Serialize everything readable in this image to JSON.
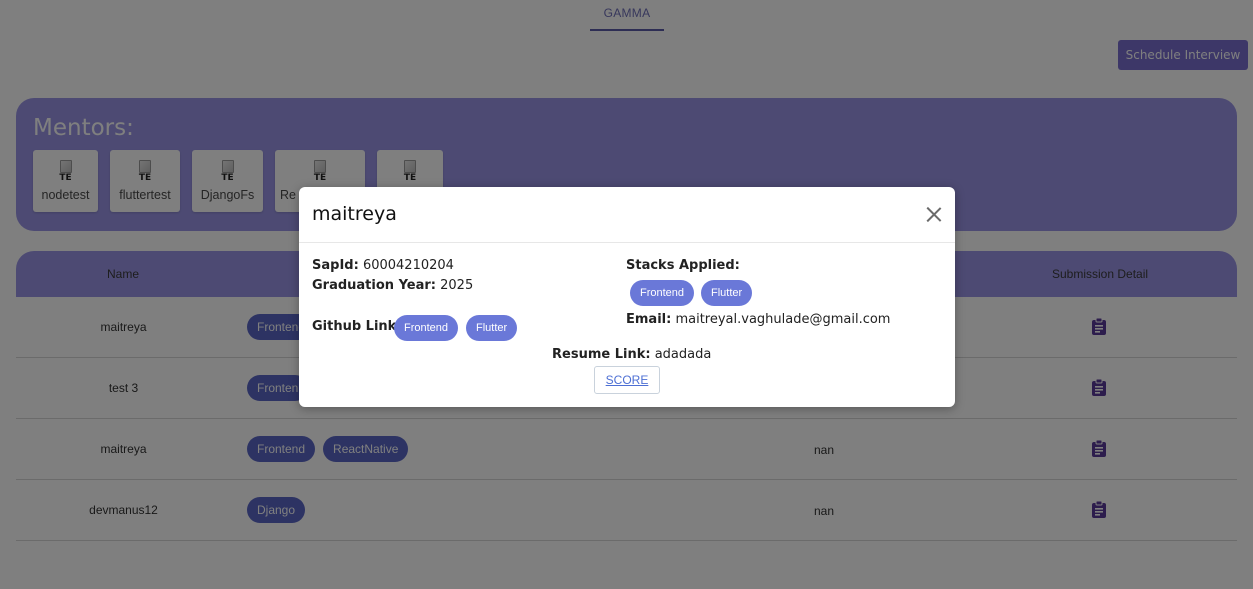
{
  "tabs": [
    {
      "label": "GAMMA",
      "active": true
    }
  ],
  "header": {
    "schedule_button": "Schedule Interview"
  },
  "mentors": {
    "title": "Mentors:",
    "image_alt": "TE",
    "items": [
      {
        "name": "nodetest"
      },
      {
        "name": "fluttertest"
      },
      {
        "name": "DjangoFs"
      },
      {
        "name": "Re"
      },
      {
        "name": ""
      }
    ]
  },
  "table": {
    "columns": {
      "name": "Name",
      "submission_detail": "Submission Detail"
    },
    "rows": [
      {
        "name": "maitreya",
        "stacks": [
          "Frontend"
        ],
        "extra": ""
      },
      {
        "name": "test 3",
        "stacks": [
          "Fronten"
        ],
        "extra": ""
      },
      {
        "name": "maitreya",
        "stacks": [
          "Frontend",
          "ReactNative"
        ],
        "extra": "nan"
      },
      {
        "name": "devmanus12",
        "stacks": [
          "Django"
        ],
        "extra": "nan"
      }
    ]
  },
  "modal": {
    "title": "maitreya",
    "sapid_label": "SapId:",
    "sapid_value": "60004210204",
    "grad_label": "Graduation Year:",
    "grad_value": "2025",
    "github_label": "Github Link:",
    "github_links": [
      "Frontend",
      "Flutter"
    ],
    "stacks_label": "Stacks Applied:",
    "stacks": [
      "Frontend",
      "Flutter"
    ],
    "email_label": "Email:",
    "email_value": "maitreyal.vaghulade@gmail.com",
    "resume_label": "Resume Link:",
    "resume_value": "adadada",
    "score_button": "SCORE"
  },
  "icons": {
    "close": "close-icon",
    "submission": "clipboard-icon"
  },
  "colors": {
    "accent": "#9a95e6",
    "chip": "#5a67c7",
    "modal_pill": "#6a78d8",
    "button": "#7b6fd0",
    "overlay": "rgba(0,0,0,0.5)"
  }
}
